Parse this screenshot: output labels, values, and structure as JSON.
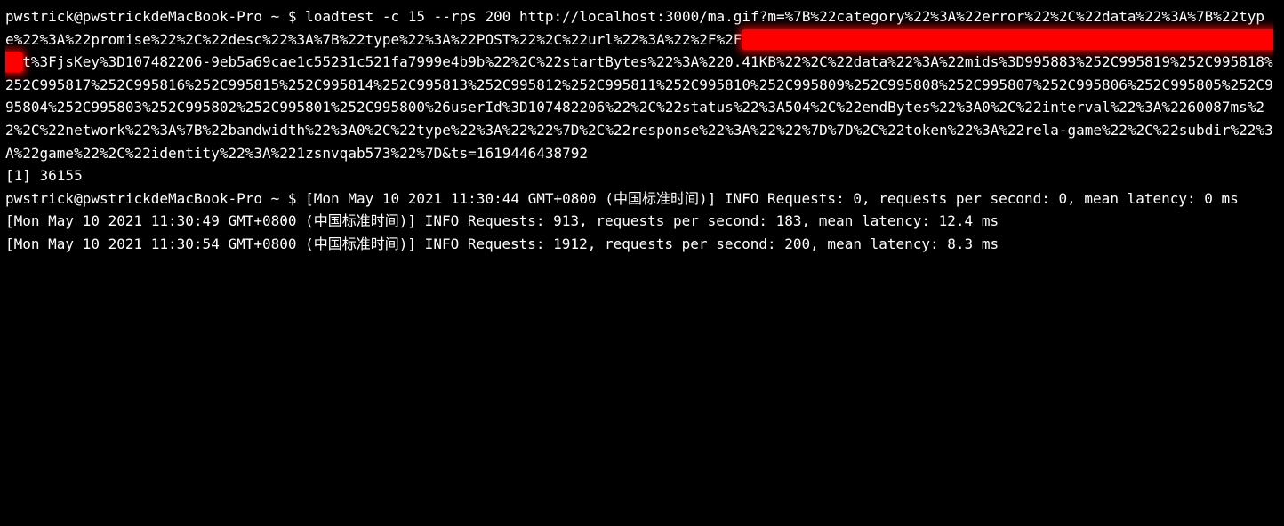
{
  "terminal": {
    "prompt1": "pwstrick@pwstrickdeMacBook-Pro ~ $ ",
    "command_part1": "loadtest -c 15 --rps 200 http://localhost:3000/ma.gif?m=%7B%22category%22%3A%22error%22%2C%22data%22%3A%7B%22type%22%3A%22promise%22%2C%22desc%22%3A%7B%22type%22%3A%22POST%22%2C%22url%22%3A%22%2F%2F",
    "redacted": "████████████████████████████████████████████████████████████████",
    "command_part2": "t%3FjsKey%3D107482206-9eb5a69cae1c55231c521fa7999e4b9b%22%2C%22startBytes%22%3A%220.41KB%22%2C%22data%22%3A%22mids%3D995883%252C995819%252C995818%252C995817%252C995816%252C995815%252C995814%252C995813%252C995812%252C995811%252C995810%252C995809%252C995808%252C995807%252C995806%252C995805%252C995804%252C995803%252C995802%252C995801%252C995800%26userId%3D107482206%22%2C%22status%22%3A504%2C%22endBytes%22%3A0%2C%22interval%22%3A%2260087ms%22%2C%22network%22%3A%7B%22bandwidth%22%3A0%2C%22type%22%3A%22%22%7D%2C%22response%22%3A%22%22%7D%7D%2C%22token%22%3A%22rela-game%22%2C%22subdir%22%3A%22game%22%2C%22identity%22%3A%221zsnvqab573%22%7D&ts=1619446438792",
    "bg_process": "[1] 36155",
    "prompt2": "pwstrick@pwstrickdeMacBook-Pro ~ $ ",
    "log_line1": "[Mon May 10 2021 11:30:44 GMT+0800 (中国标准时间)] INFO Requests: 0, requests per second: 0, mean latency: 0 ms",
    "log_line2": "[Mon May 10 2021 11:30:49 GMT+0800 (中国标准时间)] INFO Requests: 913, requests per second: 183, mean latency: 12.4 ms",
    "log_line3": "[Mon May 10 2021 11:30:54 GMT+0800 (中国标准时间)] INFO Requests: 1912, requests per second: 200, mean latency: 8.3 ms"
  }
}
